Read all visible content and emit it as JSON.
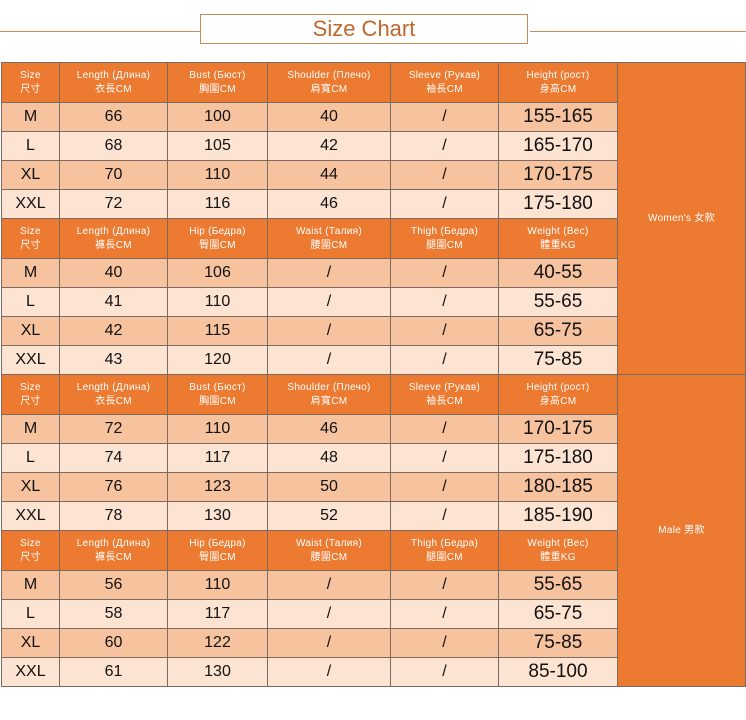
{
  "title": "Size Chart",
  "sections": [
    {
      "group": "Women's  女款",
      "tables": [
        {
          "headers": [
            [
              "Size",
              "尺寸"
            ],
            [
              "Length (Длина)",
              "衣長CM"
            ],
            [
              "Bust (Бюст)",
              "胸圍CM"
            ],
            [
              "Shoulder (Плечо)",
              "肩寬CM"
            ],
            [
              "Sleeve (Рукав)",
              "袖長CM"
            ],
            [
              "Height (рост)",
              "身高CM"
            ]
          ],
          "rows": [
            [
              "M",
              "66",
              "100",
              "40",
              "/",
              "155-165"
            ],
            [
              "L",
              "68",
              "105",
              "42",
              "/",
              "165-170"
            ],
            [
              "XL",
              "70",
              "110",
              "44",
              "/",
              "170-175"
            ],
            [
              "XXL",
              "72",
              "116",
              "46",
              "/",
              "175-180"
            ]
          ]
        },
        {
          "headers": [
            [
              "Size",
              "尺寸"
            ],
            [
              "Length (Длина)",
              "褲長CM"
            ],
            [
              "Hip (Бедра)",
              "臀圍CM"
            ],
            [
              "Waist (Талия)",
              "腰圍CM"
            ],
            [
              "Thigh (Бедра)",
              "腿圍CM"
            ],
            [
              "Weight (Вес)",
              "體重KG"
            ]
          ],
          "rows": [
            [
              "M",
              "40",
              "106",
              "/",
              "/",
              "40-55"
            ],
            [
              "L",
              "41",
              "110",
              "/",
              "/",
              "55-65"
            ],
            [
              "XL",
              "42",
              "115",
              "/",
              "/",
              "65-75"
            ],
            [
              "XXL",
              "43",
              "120",
              "/",
              "/",
              "75-85"
            ]
          ]
        }
      ]
    },
    {
      "group": "Male  男款",
      "tables": [
        {
          "headers": [
            [
              "Size",
              "尺寸"
            ],
            [
              "Length (Длина)",
              "衣長CM"
            ],
            [
              "Bust (Бюст)",
              "胸圍CM"
            ],
            [
              "Shoulder (Плечо)",
              "肩寬CM"
            ],
            [
              "Sleeve (Рукав)",
              "袖長CM"
            ],
            [
              "Height (рост)",
              "身高CM"
            ]
          ],
          "rows": [
            [
              "M",
              "72",
              "110",
              "46",
              "/",
              "170-175"
            ],
            [
              "L",
              "74",
              "117",
              "48",
              "/",
              "175-180"
            ],
            [
              "XL",
              "76",
              "123",
              "50",
              "/",
              "180-185"
            ],
            [
              "XXL",
              "78",
              "130",
              "52",
              "/",
              "185-190"
            ]
          ]
        },
        {
          "headers": [
            [
              "Size",
              "尺寸"
            ],
            [
              "Length (Длина)",
              "褲長CM"
            ],
            [
              "Hip (Бедра)",
              "臀圍CM"
            ],
            [
              "Waist (Талия)",
              "腰圍CM"
            ],
            [
              "Thigh (Бедра)",
              "腿圍CM"
            ],
            [
              "Weight (Вес)",
              "體重KG"
            ]
          ],
          "rows": [
            [
              "M",
              "56",
              "110",
              "/",
              "/",
              "55-65"
            ],
            [
              "L",
              "58",
              "117",
              "/",
              "/",
              "65-75"
            ],
            [
              "XL",
              "60",
              "122",
              "/",
              "/",
              "75-85"
            ],
            [
              "XXL",
              "61",
              "130",
              "/",
              "/",
              "85-100"
            ]
          ]
        }
      ]
    }
  ]
}
